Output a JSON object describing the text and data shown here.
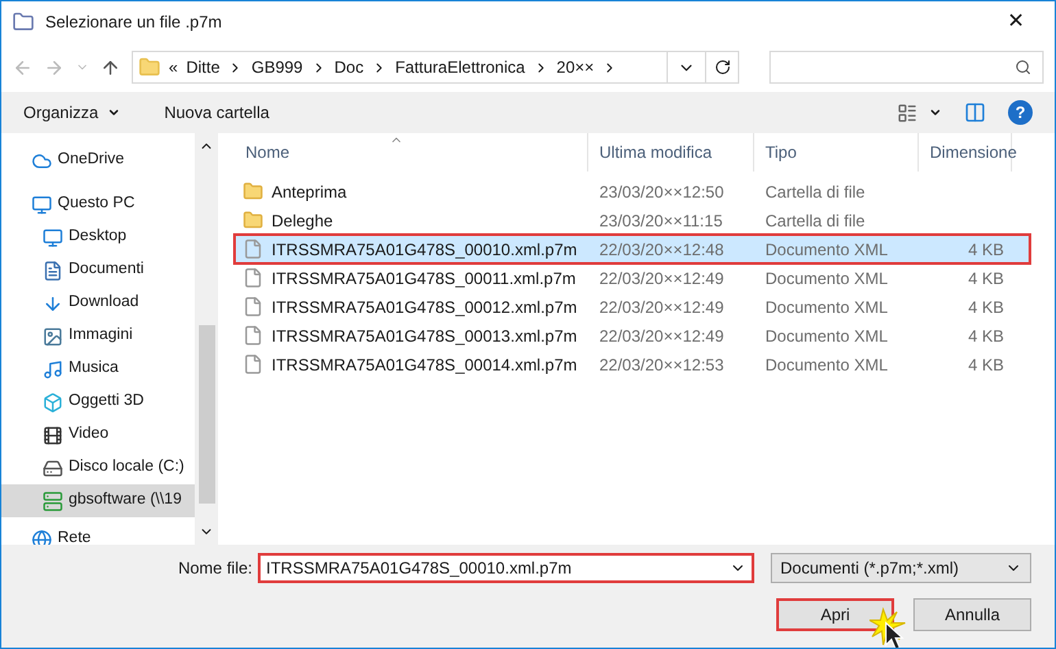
{
  "window": {
    "title": "Selezionare un file .p7m",
    "close": "✕"
  },
  "address": {
    "prefix": "«",
    "crumbs": [
      "Ditte",
      "GB999",
      "Doc",
      "FatturaElettronica",
      "20××"
    ]
  },
  "toolbar": {
    "organize": "Organizza",
    "new_folder": "Nuova cartella",
    "help": "?"
  },
  "sidebar": {
    "items": [
      {
        "label": "OneDrive",
        "kind": "cloud",
        "selected": false
      },
      {
        "label": "Questo PC",
        "kind": "pc",
        "selected": false,
        "children": [
          {
            "label": "Desktop",
            "kind": "desktop",
            "selected": false
          },
          {
            "label": "Documenti",
            "kind": "doc",
            "selected": false
          },
          {
            "label": "Download",
            "kind": "download",
            "selected": false
          },
          {
            "label": "Immagini",
            "kind": "image",
            "selected": false
          },
          {
            "label": "Musica",
            "kind": "music",
            "selected": false
          },
          {
            "label": "Oggetti 3D",
            "kind": "cube",
            "selected": false
          },
          {
            "label": "Video",
            "kind": "film",
            "selected": false
          },
          {
            "label": "Disco locale (C:)",
            "kind": "drive",
            "selected": false
          },
          {
            "label": "gbsoftware (\\\\19",
            "kind": "network-drive",
            "selected": true
          }
        ]
      },
      {
        "label": "Rete",
        "kind": "globe",
        "selected": false
      }
    ]
  },
  "table": {
    "columns": [
      "Nome",
      "Ultima modifica",
      "Tipo",
      "Dimensione"
    ],
    "rows": [
      {
        "kind": "folder",
        "name": "Anteprima",
        "modified": "23/03/20××12:50",
        "type": "Cartella di file",
        "size": "",
        "selected": false,
        "highlighted": false
      },
      {
        "kind": "folder",
        "name": "Deleghe",
        "modified": "23/03/20××11:15",
        "type": "Cartella di file",
        "size": "",
        "selected": false,
        "highlighted": false
      },
      {
        "kind": "file",
        "name": "ITRSSMRA75A01G478S_00010.xml.p7m",
        "modified": "22/03/20××12:48",
        "type": "Documento XML",
        "size": "4 KB",
        "selected": true,
        "highlighted": true
      },
      {
        "kind": "file",
        "name": "ITRSSMRA75A01G478S_00011.xml.p7m",
        "modified": "22/03/20××12:49",
        "type": "Documento XML",
        "size": "4 KB",
        "selected": false,
        "highlighted": false
      },
      {
        "kind": "file",
        "name": "ITRSSMRA75A01G478S_00012.xml.p7m",
        "modified": "22/03/20××12:49",
        "type": "Documento XML",
        "size": "4 KB",
        "selected": false,
        "highlighted": false
      },
      {
        "kind": "file",
        "name": "ITRSSMRA75A01G478S_00013.xml.p7m",
        "modified": "22/03/20××12:49",
        "type": "Documento XML",
        "size": "4 KB",
        "selected": false,
        "highlighted": false
      },
      {
        "kind": "file",
        "name": "ITRSSMRA75A01G478S_00014.xml.p7m",
        "modified": "22/03/20××12:53",
        "type": "Documento XML",
        "size": "4 KB",
        "selected": false,
        "highlighted": false
      }
    ]
  },
  "filename": {
    "label": "Nome file:",
    "value": "ITRSSMRA75A01G478S_00010.xml.p7m",
    "highlighted": true
  },
  "filter": {
    "value": "Documenti (*.p7m;*.xml)"
  },
  "buttons": [
    {
      "label": "Apri",
      "highlighted": true
    },
    {
      "label": "Annulla",
      "highlighted": false
    }
  ]
}
